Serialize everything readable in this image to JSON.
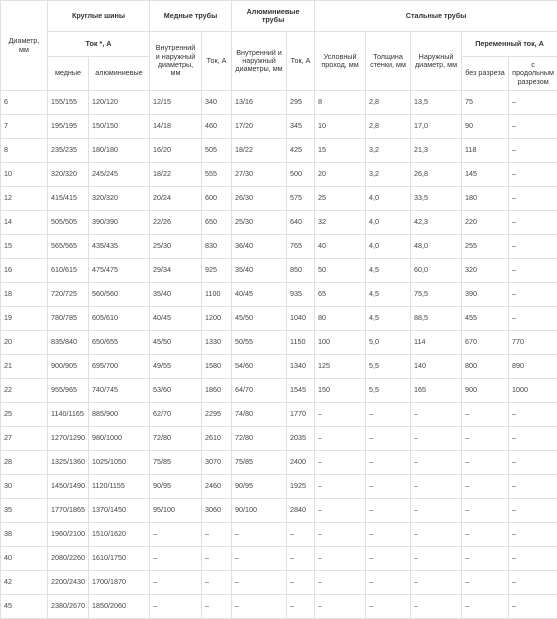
{
  "headers": {
    "diameter": "Диаметр, мм",
    "round_bars": "Круглые шины",
    "copper_pipes": "Медные трубы",
    "aluminum_pipes": "Алюминиевые трубы",
    "steel_pipes": "Стальные трубы",
    "current": "Ток *, А",
    "copper": "медные",
    "aluminum": "алюминиевые",
    "cu_diam": "Внутренний и наружный диаметры, мм",
    "cu_current": "Ток, А",
    "al_diam": "Внутренний и наружный диаметры, мм",
    "al_current": "Ток, А",
    "nominal_bore": "Условный проход, мм",
    "wall": "Толщина стенки, мм",
    "outer_diam": "Наружный диаметр, мм",
    "ac_current": "Переменный ток, А",
    "no_cut": "без разреза",
    "with_cut": "с продольным разрезом"
  },
  "rows": [
    [
      "6",
      "155/155",
      "120/120",
      "12/15",
      "340",
      "13/16",
      "295",
      "8",
      "2,8",
      "13,5",
      "75",
      "–"
    ],
    [
      "7",
      "195/195",
      "150/150",
      "14/18",
      "460",
      "17/20",
      "345",
      "10",
      "2,8",
      "17,0",
      "90",
      "–"
    ],
    [
      "8",
      "235/235",
      "180/180",
      "16/20",
      "505",
      "18/22",
      "425",
      "15",
      "3,2",
      "21,3",
      "118",
      "–"
    ],
    [
      "10",
      "320/320",
      "245/245",
      "18/22",
      "555",
      "27/30",
      "500",
      "20",
      "3,2",
      "26,8",
      "145",
      "–"
    ],
    [
      "12",
      "415/415",
      "320/320",
      "20/24",
      "600",
      "26/30",
      "575",
      "25",
      "4,0",
      "33,5",
      "180",
      "–"
    ],
    [
      "14",
      "505/505",
      "390/390",
      "22/26",
      "650",
      "25/30",
      "640",
      "32",
      "4,0",
      "42,3",
      "220",
      "–"
    ],
    [
      "15",
      "565/565",
      "435/435",
      "25/30",
      "830",
      "36/40",
      "765",
      "40",
      "4,0",
      "48,0",
      "255",
      "–"
    ],
    [
      "16",
      "610/615",
      "475/475",
      "29/34",
      "925",
      "35/40",
      "850",
      "50",
      "4,5",
      "60,0",
      "320",
      "–"
    ],
    [
      "18",
      "720/725",
      "560/560",
      "35/40",
      "1100",
      "40/45",
      "935",
      "65",
      "4,5",
      "75,5",
      "390",
      "–"
    ],
    [
      "19",
      "780/785",
      "605/610",
      "40/45",
      "1200",
      "45/50",
      "1040",
      "80",
      "4,5",
      "88,5",
      "455",
      "–"
    ],
    [
      "20",
      "835/840",
      "650/655",
      "45/50",
      "1330",
      "50/55",
      "1150",
      "100",
      "5,0",
      "114",
      "670",
      "770"
    ],
    [
      "21",
      "900/905",
      "695/700",
      "49/55",
      "1580",
      "54/60",
      "1340",
      "125",
      "5,5",
      "140",
      "800",
      "890"
    ],
    [
      "22",
      "955/965",
      "740/745",
      "53/60",
      "1860",
      "64/70",
      "1545",
      "150",
      "5,5",
      "165",
      "900",
      "1000"
    ],
    [
      "25",
      "1140/1165",
      "885/900",
      "62/70",
      "2295",
      "74/80",
      "1770",
      "–",
      "–",
      "–",
      "–",
      "–"
    ],
    [
      "27",
      "1270/1290",
      "980/1000",
      "72/80",
      "2610",
      "72/80",
      "2035",
      "–",
      "–",
      "–",
      "–",
      "–"
    ],
    [
      "28",
      "1325/1360",
      "1025/1050",
      "75/85",
      "3070",
      "75/85",
      "2400",
      "–",
      "–",
      "–",
      "–",
      "–"
    ],
    [
      "30",
      "1450/1490",
      "1120/1155",
      "90/95",
      "2460",
      "90/95",
      "1925",
      "–",
      "–",
      "–",
      "–",
      "–"
    ],
    [
      "35",
      "1770/1865",
      "1370/1450",
      "95/100",
      "3060",
      "90/100",
      "2840",
      "–",
      "–",
      "–",
      "–",
      "–"
    ],
    [
      "38",
      "1960/2100",
      "1510/1620",
      "–",
      "–",
      "–",
      "–",
      "–",
      "–",
      "–",
      "–",
      "–"
    ],
    [
      "40",
      "2080/2260",
      "1610/1750",
      "–",
      "–",
      "–",
      "–",
      "–",
      "–",
      "–",
      "–",
      "–"
    ],
    [
      "42",
      "2200/2430",
      "1700/1870",
      "–",
      "–",
      "–",
      "–",
      "–",
      "–",
      "–",
      "–",
      "–"
    ],
    [
      "45",
      "2380/2670",
      "1850/2060",
      "–",
      "–",
      "–",
      "–",
      "–",
      "–",
      "–",
      "–",
      "–"
    ]
  ]
}
